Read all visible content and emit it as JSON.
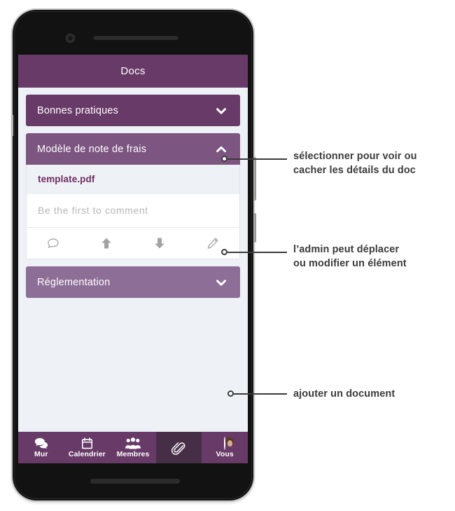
{
  "app": {
    "title": "Docs",
    "brand_color": "#683a68",
    "screen_background": "#eef1f6"
  },
  "doc_groups": [
    {
      "title": "Bonnes pratiques",
      "expanded": false,
      "chevron_icon": "chevron-down-icon",
      "color": "#683a68"
    },
    {
      "title": "Modèle de note de frais",
      "expanded": true,
      "chevron_icon": "chevron-up-icon",
      "color": "#7c5580",
      "file": {
        "name": "template.pdf",
        "name_color": "#6d2d62"
      },
      "comment": {
        "placeholder": "Be the first to comment"
      },
      "actions": [
        {
          "name": "comment-action",
          "icon": "speech-bubble-icon"
        },
        {
          "name": "move-up-action",
          "icon": "arrow-up-icon"
        },
        {
          "name": "move-down-action",
          "icon": "arrow-down-icon"
        },
        {
          "name": "edit-action",
          "icon": "pencil-icon"
        }
      ]
    },
    {
      "title": "Réglementation",
      "expanded": false,
      "chevron_icon": "chevron-down-icon",
      "color": "#8d6e96"
    }
  ],
  "fab": {
    "icon": "paperclip-icon",
    "badge": "+",
    "accent": "#683a68"
  },
  "bottom_nav": [
    {
      "label": "Mur",
      "icon": "speech-bubbles-icon",
      "active": false
    },
    {
      "label": "Calendrier",
      "icon": "calendar-icon",
      "active": false
    },
    {
      "label": "Membres",
      "icon": "people-icon",
      "active": false
    },
    {
      "label": "",
      "icon": "paperclip-icon",
      "active": true
    },
    {
      "label": "Vous",
      "icon": "avatar-icon",
      "active": false
    }
  ],
  "annotations": [
    {
      "text_line1": "sélectionner pour voir ou",
      "text_line2": "cacher les détails du doc"
    },
    {
      "text_line1": "l’admin peut déplacer",
      "text_line2": "ou modifier un élément"
    },
    {
      "text_line1": "ajouter un document",
      "text_line2": ""
    }
  ]
}
